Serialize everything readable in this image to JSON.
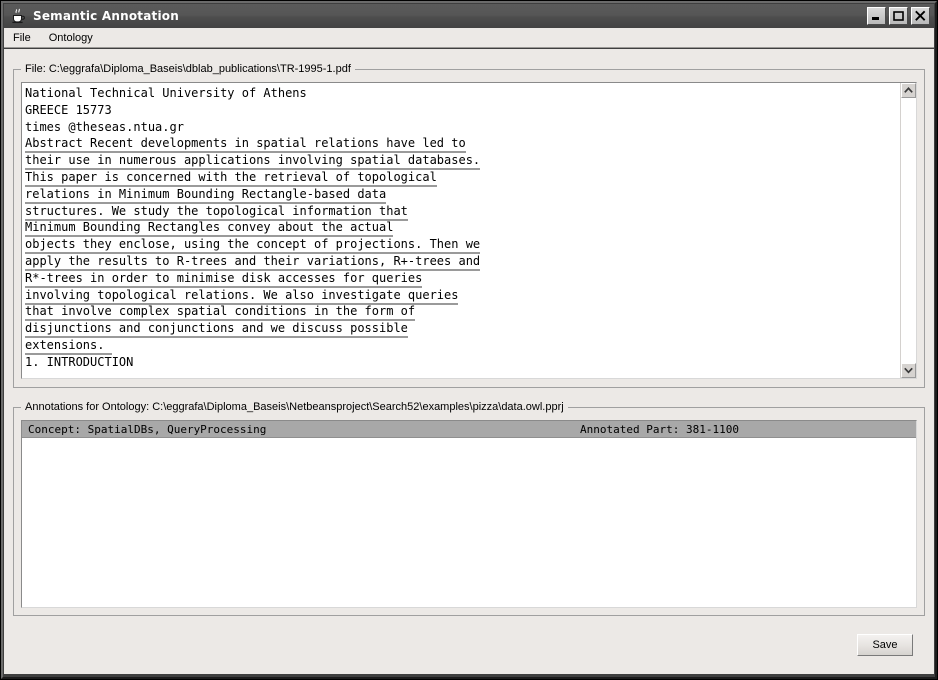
{
  "window": {
    "title": "Semantic Annotation",
    "icon": "java-coffee-cup-icon",
    "buttons": {
      "minimize": "Minimize",
      "maximize": "Maximize",
      "close": "Close"
    }
  },
  "menubar": {
    "items": [
      {
        "label": "File",
        "name": "menu-file"
      },
      {
        "label": "Ontology",
        "name": "menu-ontology"
      }
    ]
  },
  "file_panel": {
    "border_title": "File:  C:\\eggrafa\\Diploma_Baseis\\dblab_publications\\TR-1995-1.pdf",
    "label": "File:",
    "path": "C:\\eggrafa\\Diploma_Baseis\\dblab_publications\\TR-1995-1.pdf",
    "document_lines": [
      {
        "text": "National Technical University of Athens",
        "annotated": false
      },
      {
        "text": "GREECE 15773",
        "annotated": false
      },
      {
        "text": "times @theseas.ntua.gr",
        "annotated": false
      },
      {
        "text": "Abstract Recent developments in spatial relations have led to",
        "annotated": true
      },
      {
        "text": "their use in numerous applications involving spatial databases.",
        "annotated": true
      },
      {
        "text": "This paper is concerned with the retrieval of topological",
        "annotated": true
      },
      {
        "text": "relations in Minimum Bounding Rectangle-based data",
        "annotated": true
      },
      {
        "text": "structures. We study the topological information that",
        "annotated": true
      },
      {
        "text": "Minimum Bounding Rectangles convey about the actual",
        "annotated": true
      },
      {
        "text": "objects they enclose, using the concept of projections. Then we",
        "annotated": true
      },
      {
        "text": "apply the results to R-trees and their variations, R+-trees and",
        "annotated": true
      },
      {
        "text": "R*-trees in order to minimise disk accesses for queries",
        "annotated": true
      },
      {
        "text": "involving topological relations. We also investigate queries",
        "annotated": true
      },
      {
        "text": "that involve complex spatial conditions in the form of",
        "annotated": true
      },
      {
        "text": "disjunctions and conjunctions and we discuss possible",
        "annotated": true
      },
      {
        "text": "extensions. ",
        "annotated": true
      },
      {
        "text": "1. INTRODUCTION",
        "annotated": false
      }
    ],
    "scrollbar": {
      "up_arrow": "scroll-up",
      "down_arrow": "scroll-down"
    }
  },
  "annotations_panel": {
    "border_title": "Annotations for Ontology:  C:\\eggrafa\\Diploma_Baseis\\Netbeansproject\\Search52\\examples\\pizza\\data.owl.pprj",
    "label": "Annotations for Ontology:",
    "ontology_path": "C:\\eggrafa\\Diploma_Baseis\\Netbeansproject\\Search52\\examples\\pizza\\data.owl.pprj",
    "columns": [
      {
        "header": "Concept: SpatialDBs, QueryProcessing"
      },
      {
        "header": "Annotated Part: 381-1100"
      }
    ],
    "rows": []
  },
  "footer": {
    "save_label": "Save"
  },
  "colors": {
    "titlebar_top": "#5a5a5a",
    "titlebar_bottom": "#434343",
    "panel_bg": "#ece9e6",
    "table_header_bg": "#a8a8a8",
    "annotation_underline": "#9a9a9a",
    "text": "#000000"
  }
}
